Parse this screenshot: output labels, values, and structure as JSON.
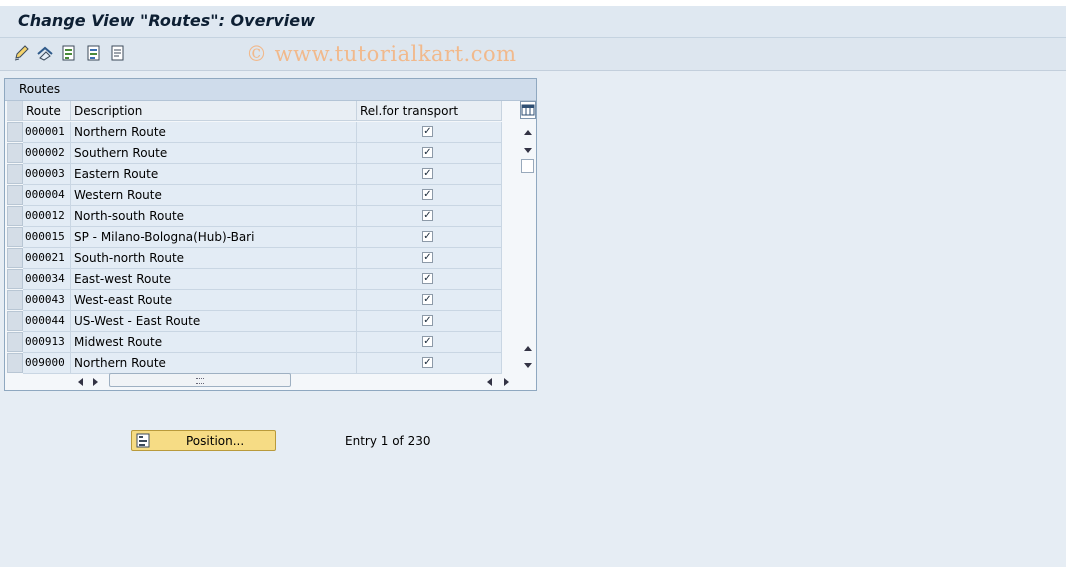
{
  "window": {
    "title": "Change View \"Routes\": Overview"
  },
  "toolbar": {
    "icons": [
      "edit-pen-icon",
      "toggle-display-change-icon",
      "new-entries-icon",
      "copy-as-icon",
      "delete-icon"
    ],
    "watermark": "© www.tutorialkart.com"
  },
  "table": {
    "title": "Routes",
    "columns": {
      "route": "Route",
      "description": "Description",
      "rel": "Rel.for transport"
    },
    "rows": [
      {
        "route": "000001",
        "description": "Northern Route",
        "rel": true
      },
      {
        "route": "000002",
        "description": "Southern Route",
        "rel": true
      },
      {
        "route": "000003",
        "description": "Eastern Route",
        "rel": true
      },
      {
        "route": "000004",
        "description": "Western Route",
        "rel": true
      },
      {
        "route": "000012",
        "description": "North-south Route",
        "rel": true
      },
      {
        "route": "000015",
        "description": "SP - Milano-Bologna(Hub)-Bari",
        "rel": true
      },
      {
        "route": "000021",
        "description": "South-north Route",
        "rel": true
      },
      {
        "route": "000034",
        "description": "East-west Route",
        "rel": true
      },
      {
        "route": "000043",
        "description": "West-east Route",
        "rel": true
      },
      {
        "route": "000044",
        "description": "US-West - East Route",
        "rel": true
      },
      {
        "route": "000913",
        "description": "Midwest Route",
        "rel": true
      },
      {
        "route": "009000",
        "description": "Northern Route",
        "rel": true
      }
    ]
  },
  "footer": {
    "position_label": "Position...",
    "entry_text": "Entry 1 of 230"
  },
  "colors": {
    "button": "#f6dc85",
    "accent": "#0d1f33"
  }
}
